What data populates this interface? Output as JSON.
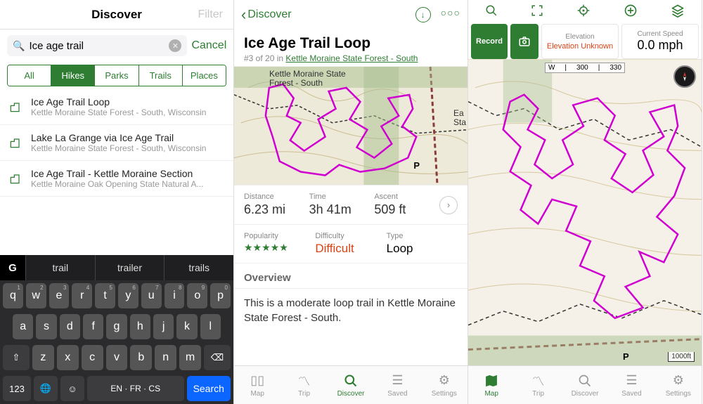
{
  "screen1": {
    "title": "Discover",
    "filter_label": "Filter",
    "search_value": "Ice age trail",
    "cancel": "Cancel",
    "filters": [
      "All",
      "Hikes",
      "Parks",
      "Trails",
      "Places"
    ],
    "active_filter": 1,
    "results": [
      {
        "title": "Ice Age Trail Loop",
        "sub": "Kettle Moraine State Forest - South, Wisconsin"
      },
      {
        "title": "Lake La Grange via Ice Age Trail",
        "sub": "Kettle Moraine State Forest - South, Wisconsin"
      },
      {
        "title": "Ice Age Trail - Kettle Moraine Section",
        "sub": "Kettle Moraine Oak Opening State Natural A..."
      }
    ],
    "kb_suggestions": [
      "trail",
      "trailer",
      "trails"
    ],
    "kb_row1": [
      "q",
      "w",
      "e",
      "r",
      "t",
      "y",
      "u",
      "i",
      "o",
      "p"
    ],
    "kb_nums": [
      "1",
      "2",
      "3",
      "4",
      "5",
      "6",
      "7",
      "8",
      "9",
      "0"
    ],
    "kb_row2": [
      "a",
      "s",
      "d",
      "f",
      "g",
      "h",
      "j",
      "k",
      "l"
    ],
    "kb_row3": [
      "z",
      "x",
      "c",
      "v",
      "b",
      "n",
      "m"
    ],
    "kb_123": "123",
    "kb_lang": "EN · FR · CS",
    "kb_search": "Search"
  },
  "screen2": {
    "back": "Discover",
    "title": "Ice Age Trail Loop",
    "rank": "#3 of 20 in ",
    "park_link": "Kettle Moraine State Forest - South",
    "map_text1": "Kettle Moraine State",
    "map_text2": "Forest - South",
    "map_text3": "Ea",
    "map_text4": "Sta",
    "stats": {
      "distance": {
        "label": "Distance",
        "val": "6.23 mi"
      },
      "time": {
        "label": "Time",
        "val": "3h 41m"
      },
      "ascent": {
        "label": "Ascent",
        "val": "509 ft"
      }
    },
    "meta": {
      "popularity": {
        "label": "Popularity",
        "val": "★★★★★"
      },
      "difficulty": {
        "label": "Difficulty",
        "val": "Difficult"
      },
      "type": {
        "label": "Type",
        "val": "Loop"
      }
    },
    "overview_h": "Overview",
    "overview_txt": "This is a moderate loop trail in Kettle Moraine State Forest - South.",
    "tabs": [
      "Map",
      "Trip",
      "Discover",
      "Saved",
      "Settings"
    ],
    "active_tab": 2
  },
  "screen3": {
    "record": "Record",
    "elev_label": "Elevation",
    "elev_val": "Elevation Unknown",
    "speed_label": "Current Speed",
    "speed_val": "0.0 mph",
    "ruler": [
      "W",
      "300",
      "330"
    ],
    "scale": "1000ft",
    "tabs": [
      "Map",
      "Trip",
      "Discover",
      "Saved",
      "Settings"
    ],
    "active_tab": 0
  }
}
